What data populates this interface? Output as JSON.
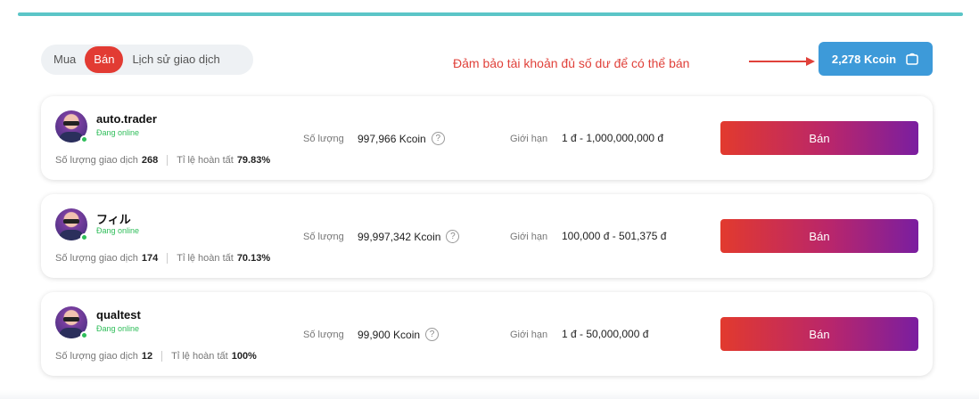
{
  "tabs": [
    {
      "label": "Mua",
      "active": false
    },
    {
      "label": "Bán",
      "active": true
    },
    {
      "label": "Lịch sử giao dịch",
      "active": false
    }
  ],
  "notice": "Đảm bảo tài khoản đủ số dư để có thể bán",
  "balance": {
    "label": "2,278 Kcoin",
    "icon": "wallet-icon"
  },
  "labels": {
    "quantity": "Số lượng",
    "limit": "Giới hạn",
    "trades": "Số lượng giao dịch",
    "completion": "Tỉ lệ hoàn tất",
    "sell": "Bán"
  },
  "offers": [
    {
      "name": "auto.trader",
      "status": "Đang online",
      "trades": "268",
      "completion": "79.83%",
      "quantity": "997,966 Kcoin",
      "limit": "1 đ - 1,000,000,000 đ"
    },
    {
      "name": "フィル",
      "status": "Đang online",
      "trades": "174",
      "completion": "70.13%",
      "quantity": "99,997,342 Kcoin",
      "limit": "100,000 đ - 501,375 đ"
    },
    {
      "name": "qualtest",
      "status": "Đang online",
      "trades": "12",
      "completion": "100%",
      "quantity": "99,900 Kcoin",
      "limit": "1 đ - 50,000,000 đ"
    }
  ],
  "colors": {
    "accent": "#e23b33",
    "balance": "#3d9ad9",
    "online": "#2ebd59",
    "topline": "#5bc5c7"
  }
}
